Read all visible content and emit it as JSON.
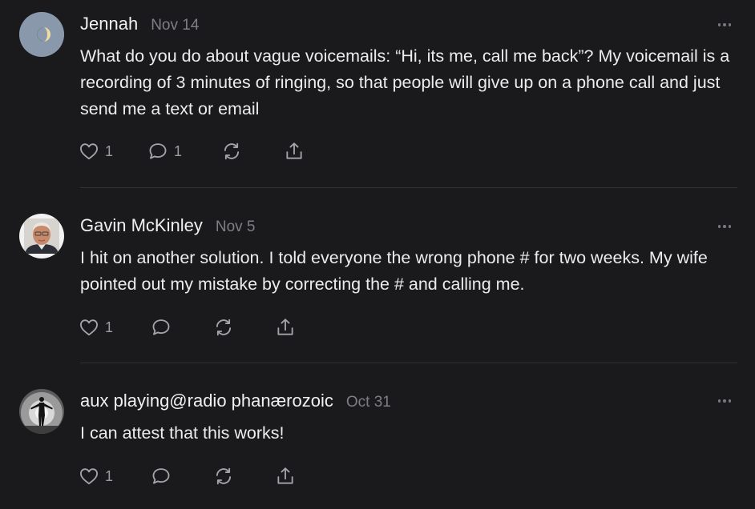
{
  "posts": [
    {
      "author": "Jennah",
      "date": "Nov 14",
      "text": "What do you do about vague voicemails: “Hi, its me, call me back”? My voicemail is a recording of 3 minutes of ringing, so that people will give up on a phone call and just send me a text or email",
      "like_count": "1",
      "comment_count": "1",
      "avatar_icon": "moon-avatar"
    },
    {
      "author": "Gavin McKinley",
      "date": "Nov 5",
      "text": "I hit on another solution. I told everyone the wrong phone # for two weeks. My wife pointed out my mistake by correcting the # and calling me.",
      "like_count": "1",
      "comment_count": "",
      "avatar_icon": "portrait-avatar"
    },
    {
      "author": "aux playing@radio phanærozoic",
      "date": "Oct 31",
      "text": "I can attest that this works!",
      "like_count": "1",
      "comment_count": "",
      "avatar_icon": "silhouette-avatar"
    }
  ],
  "icons": {
    "like": "heart-icon",
    "comment": "comment-bubble-icon",
    "restack": "restack-icon",
    "share": "share-icon",
    "more": "more-options-icon"
  },
  "colors": {
    "background": "#1a1a1c",
    "text": "#ececee",
    "muted": "#7e7f86",
    "icon": "#a4a5ab",
    "divider": "#313134"
  }
}
